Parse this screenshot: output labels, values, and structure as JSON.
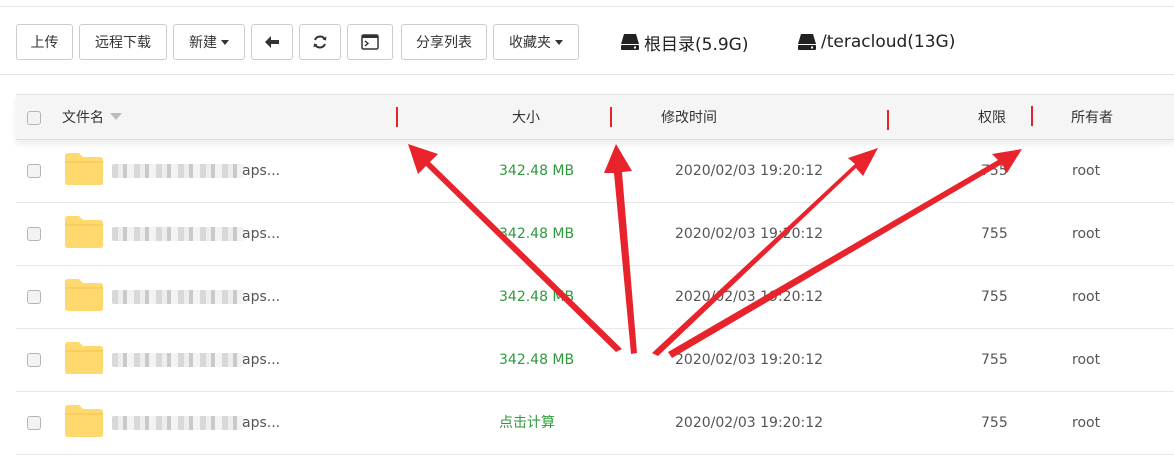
{
  "toolbar": {
    "upload": "上传",
    "remote_download": "远程下载",
    "new": "新建",
    "share_list": "分享列表",
    "favorites": "收藏夹"
  },
  "disks": [
    {
      "label": "根目录(5.9G)"
    },
    {
      "label": "/teracloud(13G)"
    }
  ],
  "table": {
    "columns": {
      "name": "文件名",
      "size": "大小",
      "modified": "修改时间",
      "permission": "权限",
      "owner": "所有者"
    },
    "rows": [
      {
        "name_suffix": "aps...",
        "size": "342.48 MB",
        "modified": "2020/02/03 19:20:12",
        "permission": "755",
        "owner": "root"
      },
      {
        "name_suffix": "aps...",
        "size": "342.48 MB",
        "modified": "2020/02/03 19:20:12",
        "permission": "755",
        "owner": "root"
      },
      {
        "name_suffix": "aps...",
        "size": "342.48 MB",
        "modified": "2020/02/03 19:20:12",
        "permission": "755",
        "owner": "root"
      },
      {
        "name_suffix": "aps...",
        "size": "342.48 MB",
        "modified": "2020/02/03 19:20:12",
        "permission": "755",
        "owner": "root"
      },
      {
        "name_suffix": "aps...",
        "size": "点击计算",
        "modified": "2020/02/03 19:20:12",
        "permission": "755",
        "owner": "root"
      }
    ]
  },
  "colors": {
    "size_text": "#2f9a3d",
    "folder": "#ffd96e",
    "annotation": "#e8232b"
  },
  "icons": [
    "hdd-icon",
    "back-arrow-icon",
    "refresh-icon",
    "terminal-icon",
    "folder-icon",
    "checkbox-icon",
    "sort-caret-icon"
  ]
}
